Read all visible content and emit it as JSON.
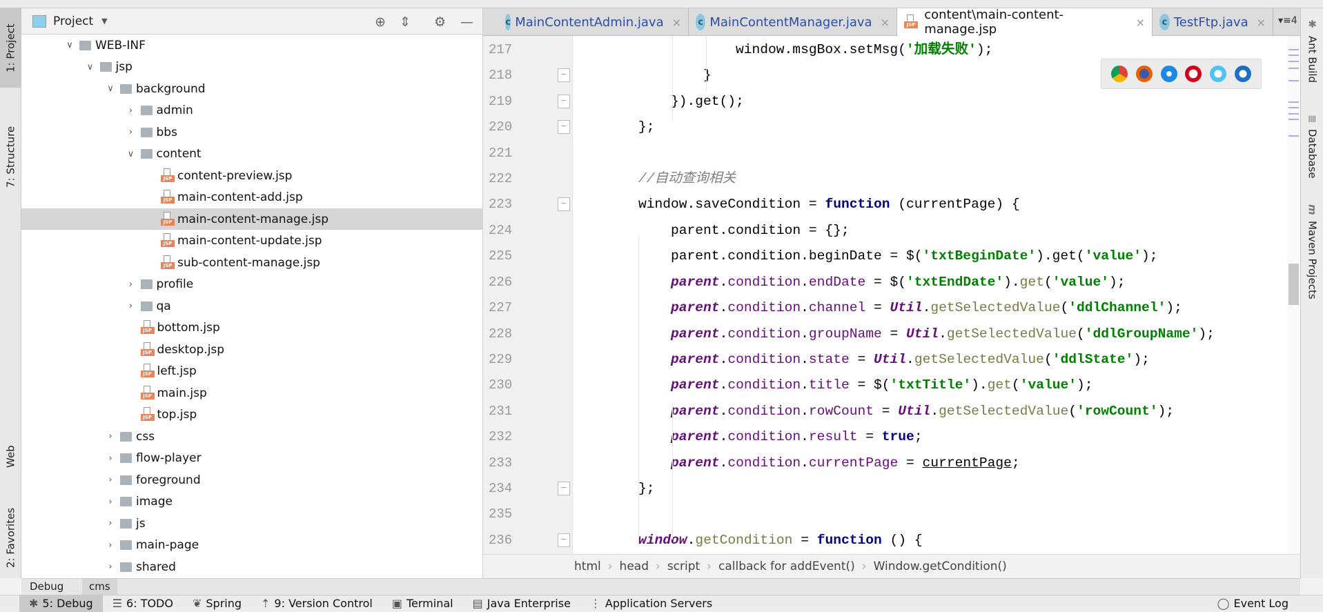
{
  "left_tabs": [
    "1: Project",
    "7: Structure",
    "Web",
    "2: Favorites"
  ],
  "right_tabs": [
    "Ant Build",
    "Database",
    "Maven Projects"
  ],
  "project": {
    "title": "Project",
    "tree": [
      {
        "label": "WEB-INF",
        "level": 0,
        "type": "folder",
        "arrow": "down"
      },
      {
        "label": "jsp",
        "level": 1,
        "type": "folder",
        "arrow": "down"
      },
      {
        "label": "background",
        "level": 2,
        "type": "folder",
        "arrow": "down"
      },
      {
        "label": "admin",
        "level": 3,
        "type": "folder",
        "arrow": "right"
      },
      {
        "label": "bbs",
        "level": 3,
        "type": "folder",
        "arrow": "right"
      },
      {
        "label": "content",
        "level": 3,
        "type": "folder",
        "arrow": "down"
      },
      {
        "label": "content-preview.jsp",
        "level": 4,
        "type": "jsp"
      },
      {
        "label": "main-content-add.jsp",
        "level": 4,
        "type": "jsp"
      },
      {
        "label": "main-content-manage.jsp",
        "level": 4,
        "type": "jsp",
        "selected": true
      },
      {
        "label": "main-content-update.jsp",
        "level": 4,
        "type": "jsp"
      },
      {
        "label": "sub-content-manage.jsp",
        "level": 4,
        "type": "jsp"
      },
      {
        "label": "profile",
        "level": 3,
        "type": "folder",
        "arrow": "right"
      },
      {
        "label": "qa",
        "level": 3,
        "type": "folder",
        "arrow": "right"
      },
      {
        "label": "bottom.jsp",
        "level": 3,
        "type": "jsp"
      },
      {
        "label": "desktop.jsp",
        "level": 3,
        "type": "jsp"
      },
      {
        "label": "left.jsp",
        "level": 3,
        "type": "jsp"
      },
      {
        "label": "main.jsp",
        "level": 3,
        "type": "jsp"
      },
      {
        "label": "top.jsp",
        "level": 3,
        "type": "jsp"
      },
      {
        "label": "css",
        "level": 2,
        "type": "folder",
        "arrow": "right"
      },
      {
        "label": "flow-player",
        "level": 2,
        "type": "folder",
        "arrow": "right"
      },
      {
        "label": "foreground",
        "level": 2,
        "type": "folder",
        "arrow": "right"
      },
      {
        "label": "image",
        "level": 2,
        "type": "folder",
        "arrow": "right"
      },
      {
        "label": "js",
        "level": 2,
        "type": "folder",
        "arrow": "right"
      },
      {
        "label": "main-page",
        "level": 2,
        "type": "folder",
        "arrow": "right"
      },
      {
        "label": "shared",
        "level": 2,
        "type": "folder",
        "arrow": "right"
      }
    ]
  },
  "tabs": [
    {
      "label": "MainContentAdmin.java",
      "icon": "c"
    },
    {
      "label": "MainContentManager.java",
      "icon": "c"
    },
    {
      "label": "content\\main-content-manage.jsp",
      "icon": "jsp",
      "active": true
    },
    {
      "label": "TestFtp.java",
      "icon": "c"
    }
  ],
  "tabs_overflow": "4",
  "browsers": [
    "chrome",
    "firefox",
    "safari",
    "opera",
    "ie",
    "edge"
  ],
  "code": [
    {
      "n": "217",
      "i": 3,
      "t": [
        [
          "window.msgBox.setMsg(",
          ""
        ],
        [
          "'加载失败'",
          "str"
        ],
        [
          ");",
          ""
        ]
      ]
    },
    {
      "n": "218",
      "i": 2,
      "f": 1,
      "t": [
        [
          "}",
          ""
        ]
      ]
    },
    {
      "n": "219",
      "i": 1,
      "f": 1,
      "t": [
        [
          "}).get();",
          ""
        ]
      ]
    },
    {
      "n": "220",
      "i": 0,
      "f": 1,
      "t": [
        [
          "};",
          ""
        ]
      ]
    },
    {
      "n": "221",
      "i": 0,
      "t": []
    },
    {
      "n": "222",
      "i": 0,
      "t": [
        [
          "//自动查询相关",
          "cm"
        ]
      ]
    },
    {
      "n": "223",
      "i": 0,
      "f": 1,
      "t": [
        [
          "window.saveCondition = ",
          ""
        ],
        [
          "function",
          "kw"
        ],
        [
          " (currentPage) {",
          ""
        ]
      ]
    },
    {
      "n": "224",
      "i": 1,
      "t": [
        [
          "parent.condition = {};",
          ""
        ]
      ]
    },
    {
      "n": "225",
      "i": 1,
      "t": [
        [
          "parent.condition.beginDate = $(",
          ""
        ],
        [
          "'txtBeginDate'",
          "str"
        ],
        [
          ").get(",
          ""
        ],
        [
          "'value'",
          "str"
        ],
        [
          ");",
          ""
        ]
      ]
    },
    {
      "n": "226",
      "i": 1,
      "t": [
        [
          "parent",
          "it"
        ],
        [
          ".",
          ""
        ],
        [
          "condition",
          "fld"
        ],
        [
          ".",
          ""
        ],
        [
          "endDate",
          "fld"
        ],
        [
          " = $(",
          ""
        ],
        [
          "'txtEndDate'",
          "str"
        ],
        [
          ").",
          ""
        ],
        [
          "get",
          "meth"
        ],
        [
          "(",
          ""
        ],
        [
          "'value'",
          "str"
        ],
        [
          ");",
          ""
        ]
      ]
    },
    {
      "n": "227",
      "i": 1,
      "t": [
        [
          "parent",
          "it"
        ],
        [
          ".",
          ""
        ],
        [
          "condition",
          "fld"
        ],
        [
          ".",
          ""
        ],
        [
          "channel",
          "fld"
        ],
        [
          " = ",
          ""
        ],
        [
          "Util",
          "it"
        ],
        [
          ".",
          ""
        ],
        [
          "getSelectedValue",
          "meth"
        ],
        [
          "(",
          ""
        ],
        [
          "'ddlChannel'",
          "str"
        ],
        [
          ");",
          ""
        ]
      ]
    },
    {
      "n": "228",
      "i": 1,
      "t": [
        [
          "parent",
          "it"
        ],
        [
          ".",
          ""
        ],
        [
          "condition",
          "fld"
        ],
        [
          ".",
          ""
        ],
        [
          "groupName",
          "fld"
        ],
        [
          " = ",
          ""
        ],
        [
          "Util",
          "it"
        ],
        [
          ".",
          ""
        ],
        [
          "getSelectedValue",
          "meth"
        ],
        [
          "(",
          ""
        ],
        [
          "'ddlGroupName'",
          "str"
        ],
        [
          ");",
          ""
        ]
      ]
    },
    {
      "n": "229",
      "i": 1,
      "t": [
        [
          "parent",
          "it"
        ],
        [
          ".",
          ""
        ],
        [
          "condition",
          "fld"
        ],
        [
          ".",
          ""
        ],
        [
          "state",
          "fld"
        ],
        [
          " = ",
          ""
        ],
        [
          "Util",
          "it"
        ],
        [
          ".",
          ""
        ],
        [
          "getSelectedValue",
          "meth"
        ],
        [
          "(",
          ""
        ],
        [
          "'ddlState'",
          "str"
        ],
        [
          ");",
          ""
        ]
      ]
    },
    {
      "n": "230",
      "i": 1,
      "t": [
        [
          "parent",
          "it"
        ],
        [
          ".",
          ""
        ],
        [
          "condition",
          "fld"
        ],
        [
          ".",
          ""
        ],
        [
          "title",
          "fld"
        ],
        [
          " = $(",
          ""
        ],
        [
          "'txtTitle'",
          "str"
        ],
        [
          ").",
          ""
        ],
        [
          "get",
          "meth"
        ],
        [
          "(",
          ""
        ],
        [
          "'value'",
          "str"
        ],
        [
          ");",
          ""
        ]
      ]
    },
    {
      "n": "231",
      "i": 1,
      "t": [
        [
          "parent",
          "it"
        ],
        [
          ".",
          ""
        ],
        [
          "condition",
          "fld"
        ],
        [
          ".",
          ""
        ],
        [
          "rowCount",
          "fld"
        ],
        [
          " = ",
          ""
        ],
        [
          "Util",
          "it"
        ],
        [
          ".",
          ""
        ],
        [
          "getSelectedValue",
          "meth"
        ],
        [
          "(",
          ""
        ],
        [
          "'rowCount'",
          "str"
        ],
        [
          ");",
          ""
        ]
      ]
    },
    {
      "n": "232",
      "i": 1,
      "t": [
        [
          "parent",
          "it"
        ],
        [
          ".",
          ""
        ],
        [
          "condition",
          "fld"
        ],
        [
          ".",
          ""
        ],
        [
          "result",
          "fld"
        ],
        [
          " = ",
          ""
        ],
        [
          "true",
          "kw"
        ],
        [
          ";",
          ""
        ]
      ]
    },
    {
      "n": "233",
      "i": 1,
      "t": [
        [
          "parent",
          "it"
        ],
        [
          ".",
          ""
        ],
        [
          "condition",
          "fld"
        ],
        [
          ".",
          ""
        ],
        [
          "currentPage",
          "fld"
        ],
        [
          " = ",
          ""
        ],
        [
          "currentPage",
          "ul"
        ],
        [
          ";",
          ""
        ]
      ]
    },
    {
      "n": "234",
      "i": 0,
      "f": 1,
      "t": [
        [
          "};",
          ""
        ]
      ]
    },
    {
      "n": "235",
      "i": 0,
      "t": []
    },
    {
      "n": "236",
      "i": 0,
      "f": 1,
      "t": [
        [
          "window",
          "it"
        ],
        [
          ".",
          ""
        ],
        [
          "getCondition",
          "meth"
        ],
        [
          " = ",
          ""
        ],
        [
          "function",
          "kw"
        ],
        [
          " () {",
          ""
        ]
      ]
    }
  ],
  "breadcrumb": [
    "html",
    "head",
    "script",
    "callback for addEvent()",
    "Window.getCondition()"
  ],
  "debug_tabs": [
    "Debug",
    "cms"
  ],
  "status": {
    "items": [
      "5: Debug",
      "6: TODO",
      "Spring",
      "9: Version Control",
      "Terminal",
      "Java Enterprise",
      "Application Servers"
    ],
    "event_log": "Event Log"
  }
}
